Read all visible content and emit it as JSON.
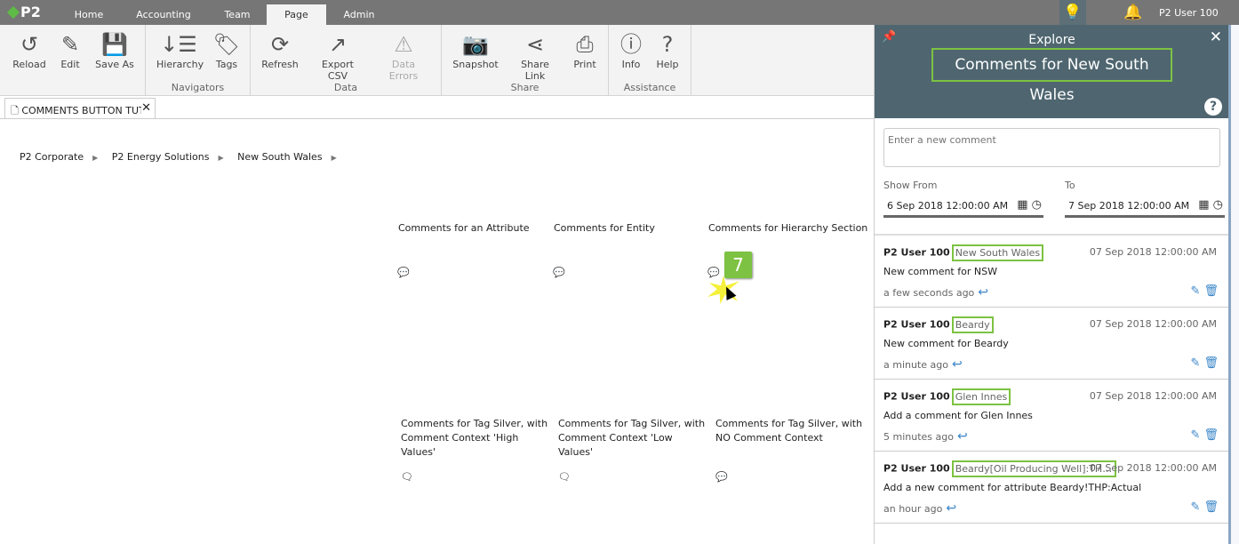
{
  "app": {
    "logo": "P2",
    "nav_tabs": [
      "Home",
      "Accounting",
      "Team",
      "Page",
      "Admin"
    ],
    "active_tab": "Page",
    "user": "P2 User 100"
  },
  "ribbon": {
    "groups": [
      {
        "label": "",
        "buttons": [
          "Reload",
          "Edit",
          "Save As"
        ]
      },
      {
        "label": "Navigators",
        "buttons": [
          "Hierarchy",
          "Tags"
        ]
      },
      {
        "label": "Data",
        "buttons": [
          "Refresh",
          "Export CSV",
          "Data Errors"
        ]
      },
      {
        "label": "Share",
        "buttons": [
          "Snapshot",
          "Share Link",
          "Print"
        ]
      },
      {
        "label": "Assistance",
        "buttons": [
          "Info",
          "Help"
        ]
      }
    ]
  },
  "doc_tab": {
    "label": "COMMENTS BUTTON TUT"
  },
  "breadcrumb": [
    "P2 Corporate",
    "P2 Energy Solutions",
    "New South Wales"
  ],
  "cells": [
    "Comments for an Attribute",
    "Comments for Entity",
    "Comments for Hierarchy Section",
    "Comments for Tag Silver, with Comment Context 'High Values'",
    "Comments for Tag Silver, with Comment Context 'Low Values'",
    "Comments for Tag Silver, with NO Comment Context"
  ],
  "step_badge": "7",
  "panel": {
    "header": "Explore",
    "title": "Comments for New South Wales",
    "new_comment_placeholder": "Enter a new comment",
    "show_from_label": "Show From",
    "to_label": "To",
    "from": "6 Sep 2018 12:00:00 AM",
    "to": "7 Sep 2018 12:00:00 AM",
    "comments": [
      {
        "user": "P2 User 100",
        "context": "New South Wales",
        "date": "07 Sep 2018 12:00:00 AM",
        "text": "New comment for NSW",
        "ago": "a few seconds ago"
      },
      {
        "user": "P2 User 100",
        "context": "Beardy",
        "date": "07 Sep 2018 12:00:00 AM",
        "text": "New comment for Beardy",
        "ago": "a minute ago"
      },
      {
        "user": "P2 User 100",
        "context": "Glen Innes",
        "date": "07 Sep 2018 12:00:00 AM",
        "text": "Add a comment for Glen Innes",
        "ago": "5 minutes ago"
      },
      {
        "user": "P2 User 100",
        "context": "Beardy[Oil Producing Well]:THP!Ac...",
        "date": "07 Sep 2018 12:00:00 AM",
        "text": "Add a new comment for attribute Beardy!THP:Actual",
        "ago": "an hour ago"
      }
    ]
  },
  "colors": {
    "topbar": "#767676",
    "panel_header": "#4f6670",
    "highlight": "#7dc242",
    "action": "#3a86c8"
  }
}
